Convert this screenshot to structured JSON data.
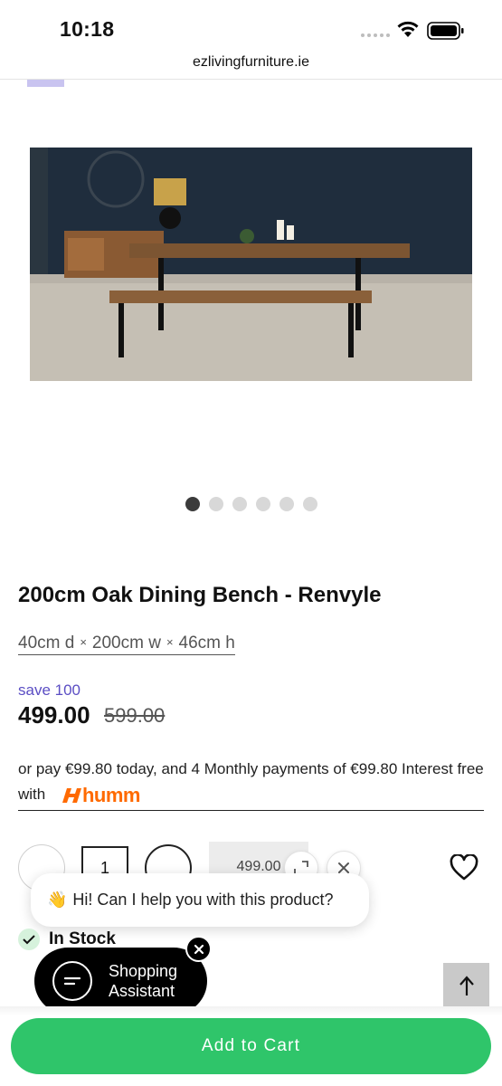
{
  "status_bar": {
    "time": "10:18"
  },
  "browser": {
    "url": "ezlivingfurniture.ie"
  },
  "gallery": {
    "image_alt": "oak-dining-table-and-bench-photo",
    "dot_count": 6,
    "active_index": 0
  },
  "product": {
    "title": "200cm Oak Dining Bench - Renvyle",
    "dims": {
      "d": "40cm d",
      "w": "200cm w",
      "h": "46cm h",
      "sep": "×"
    },
    "save_label": "save 100",
    "price": "499.00",
    "old_price": "599.00"
  },
  "financing": {
    "text": "or pay €99.80 today, and 4 Monthly payments of €99.80 Interest free with",
    "logo_text": "humm"
  },
  "purchase": {
    "quantity": "1",
    "price_pill": "499.00"
  },
  "chat": {
    "greeting_emoji": "👋",
    "greeting": "Hi! Can I help you with this product?"
  },
  "stock": {
    "label": "In Stock"
  },
  "assistant": {
    "label": "Shopping Assistant"
  },
  "cart": {
    "button_label": "Add to Cart"
  },
  "colors": {
    "accent_green": "#2fc56a",
    "save_purple": "#5b4ec4",
    "humm_orange": "#ff6a00"
  }
}
